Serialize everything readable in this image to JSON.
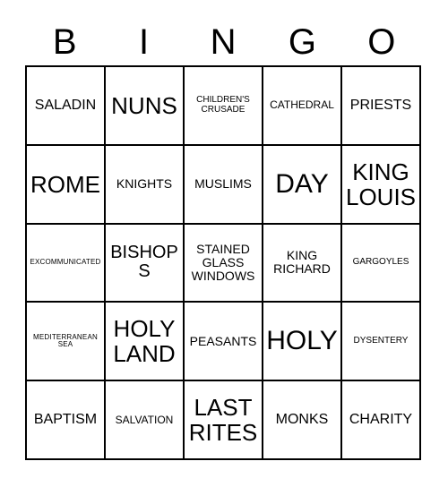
{
  "card": {
    "header_letters": [
      "B",
      "I",
      "N",
      "G",
      "O"
    ],
    "colors": {
      "background": "#ffffff",
      "text": "#000000",
      "grid_line": "#000000"
    },
    "grid": {
      "columns": 5,
      "rows": 5,
      "cells": [
        [
          {
            "text": "SALADIN",
            "size": "t-l"
          },
          {
            "text": "NUNS",
            "size": "t-xxl"
          },
          {
            "text": "CHILDREN'S\nCRUSADE",
            "size": "t-xs"
          },
          {
            "text": "CATHEDRAL",
            "size": "t-s"
          },
          {
            "text": "PRIESTS",
            "size": "t-l"
          }
        ],
        [
          {
            "text": "ROME",
            "size": "t-xxl"
          },
          {
            "text": "KNIGHTS",
            "size": "t-m"
          },
          {
            "text": "MUSLIMS",
            "size": "t-m"
          },
          {
            "text": "DAY",
            "size": "t-huge"
          },
          {
            "text": "KING\nLOUIS",
            "size": "t-xxl"
          }
        ],
        [
          {
            "text": "EXCOMMUNICATED",
            "size": "t-xxs"
          },
          {
            "text": "BISHOPS",
            "size": "t-xl"
          },
          {
            "text": "STAINED\nGLASS\nWINDOWS",
            "size": "t-m"
          },
          {
            "text": "KING\nRICHARD",
            "size": "t-m"
          },
          {
            "text": "GARGOYLES",
            "size": "t-xs"
          }
        ],
        [
          {
            "text": "MEDITERRANEAN\nSEA",
            "size": "t-xxs"
          },
          {
            "text": "HOLY\nLAND",
            "size": "t-xxl"
          },
          {
            "text": "PEASANTS",
            "size": "t-m"
          },
          {
            "text": "HOLY",
            "size": "t-huge"
          },
          {
            "text": "DYSENTERY",
            "size": "t-xs"
          }
        ],
        [
          {
            "text": "BAPTISM",
            "size": "t-l"
          },
          {
            "text": "SALVATION",
            "size": "t-s"
          },
          {
            "text": "LAST\nRITES",
            "size": "t-xxl"
          },
          {
            "text": "MONKS",
            "size": "t-l"
          },
          {
            "text": "CHARITY",
            "size": "t-l"
          }
        ]
      ]
    }
  }
}
